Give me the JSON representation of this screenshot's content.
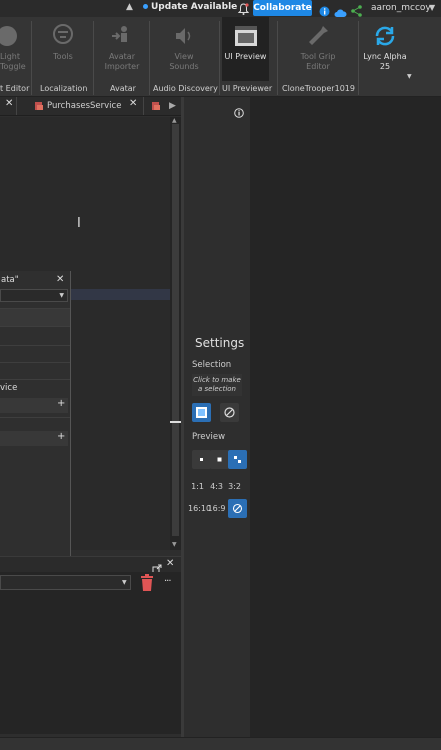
{
  "topbar": {
    "update_label": "Update Available",
    "collaborate_label": "Collaborate",
    "username": "aaron_mccoy"
  },
  "ribbon": {
    "items": [
      {
        "label_line1": "Light",
        "label_line2": "Toggle"
      },
      {
        "label_line1": "Tools",
        "label_line2": ""
      },
      {
        "label_line1": "Avatar",
        "label_line2": "Importer"
      },
      {
        "label_line1": "View",
        "label_line2": "Sounds"
      },
      {
        "label_line1": "UI Preview",
        "label_line2": ""
      },
      {
        "label_line1": "Tool Grip",
        "label_line2": "Editor"
      },
      {
        "label_line1": "Lync Alpha",
        "label_line2": "25"
      }
    ],
    "sections": [
      "t Editor",
      "Localization",
      "Avatar",
      "Audio Discovery",
      "UI Previewer",
      "CloneTrooper1019"
    ]
  },
  "tabs": {
    "tab2_label": "PurchasesService"
  },
  "popup": {
    "title": "ata\"",
    "row_text": "vice"
  },
  "plugin": {
    "settings_title": "Settings",
    "selection_label": "Selection",
    "selection_hint": "Click to make a selection",
    "preview_label": "Preview",
    "ratios": [
      "1:1",
      "4:3",
      "3:2",
      "16:10",
      "16:9"
    ]
  },
  "colors": {
    "accent": "#1e88e5",
    "selected": "#2b6fb5",
    "delete": "#e05555"
  }
}
